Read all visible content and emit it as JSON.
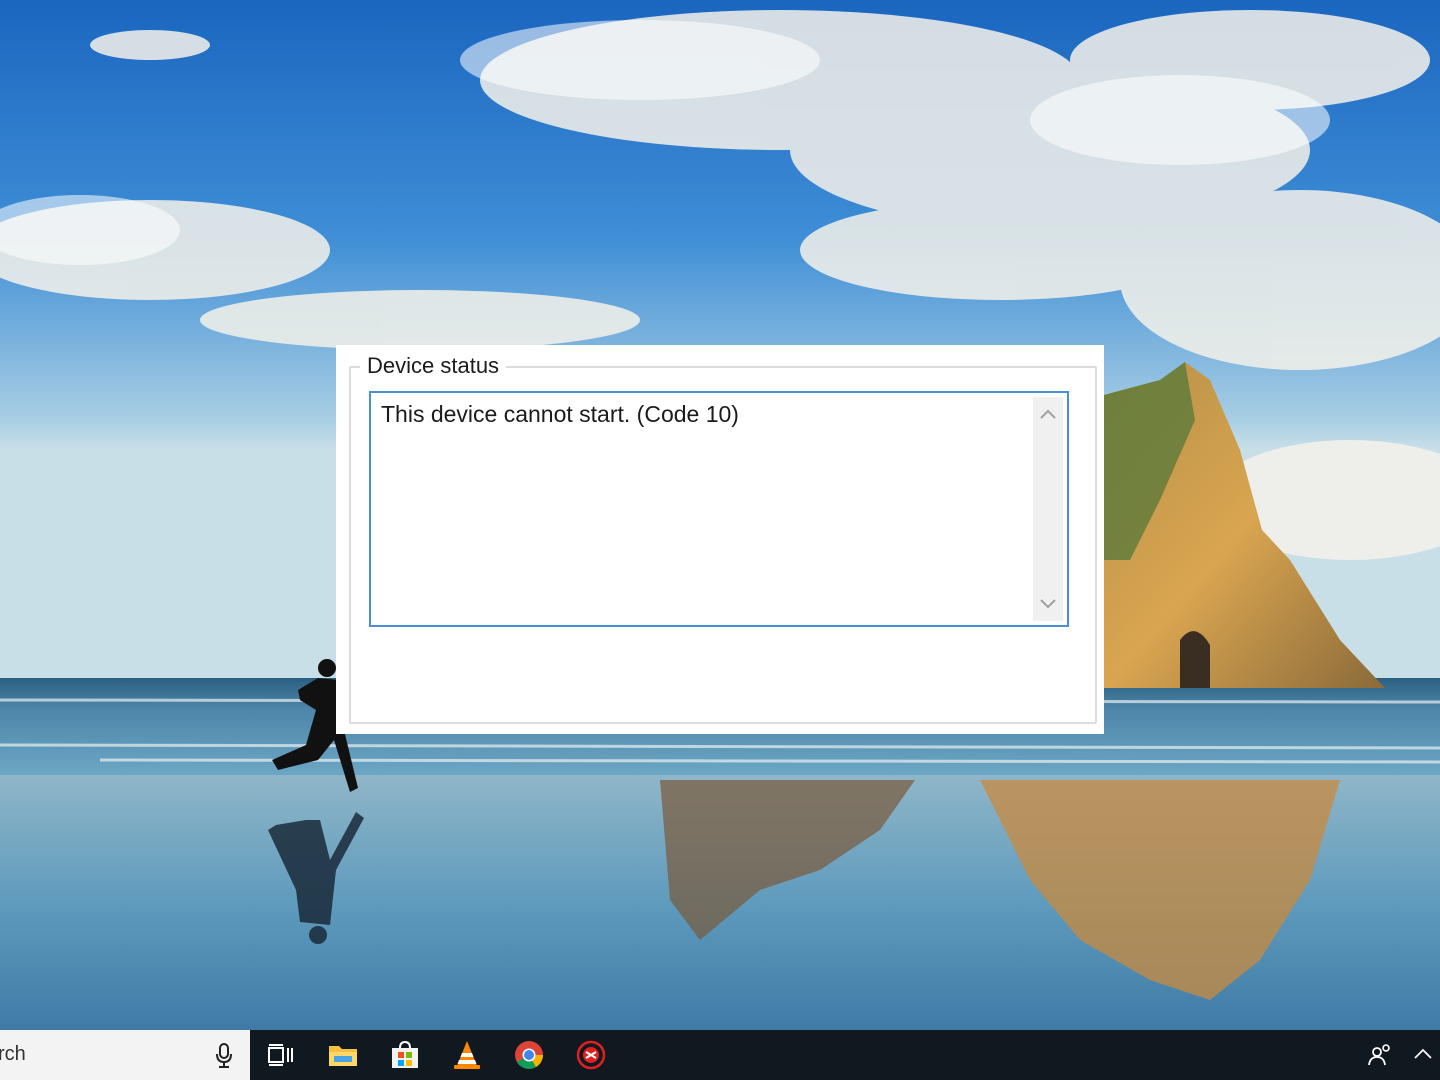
{
  "dialog": {
    "group_title": "Device status",
    "status_text": "This device cannot start. (Code 10)"
  },
  "taskbar": {
    "search_text": "rch",
    "icons": [
      "task-view-icon",
      "file-explorer-icon",
      "microsoft-store-icon",
      "vlc-icon",
      "chrome-icon",
      "red-app-icon"
    ],
    "tray_icons": [
      "people-icon",
      "chevron-up-icon"
    ]
  },
  "colors": {
    "textbox_border": "#4a90d9",
    "taskbar": "#101820",
    "search_box": "#f3f3f3"
  }
}
